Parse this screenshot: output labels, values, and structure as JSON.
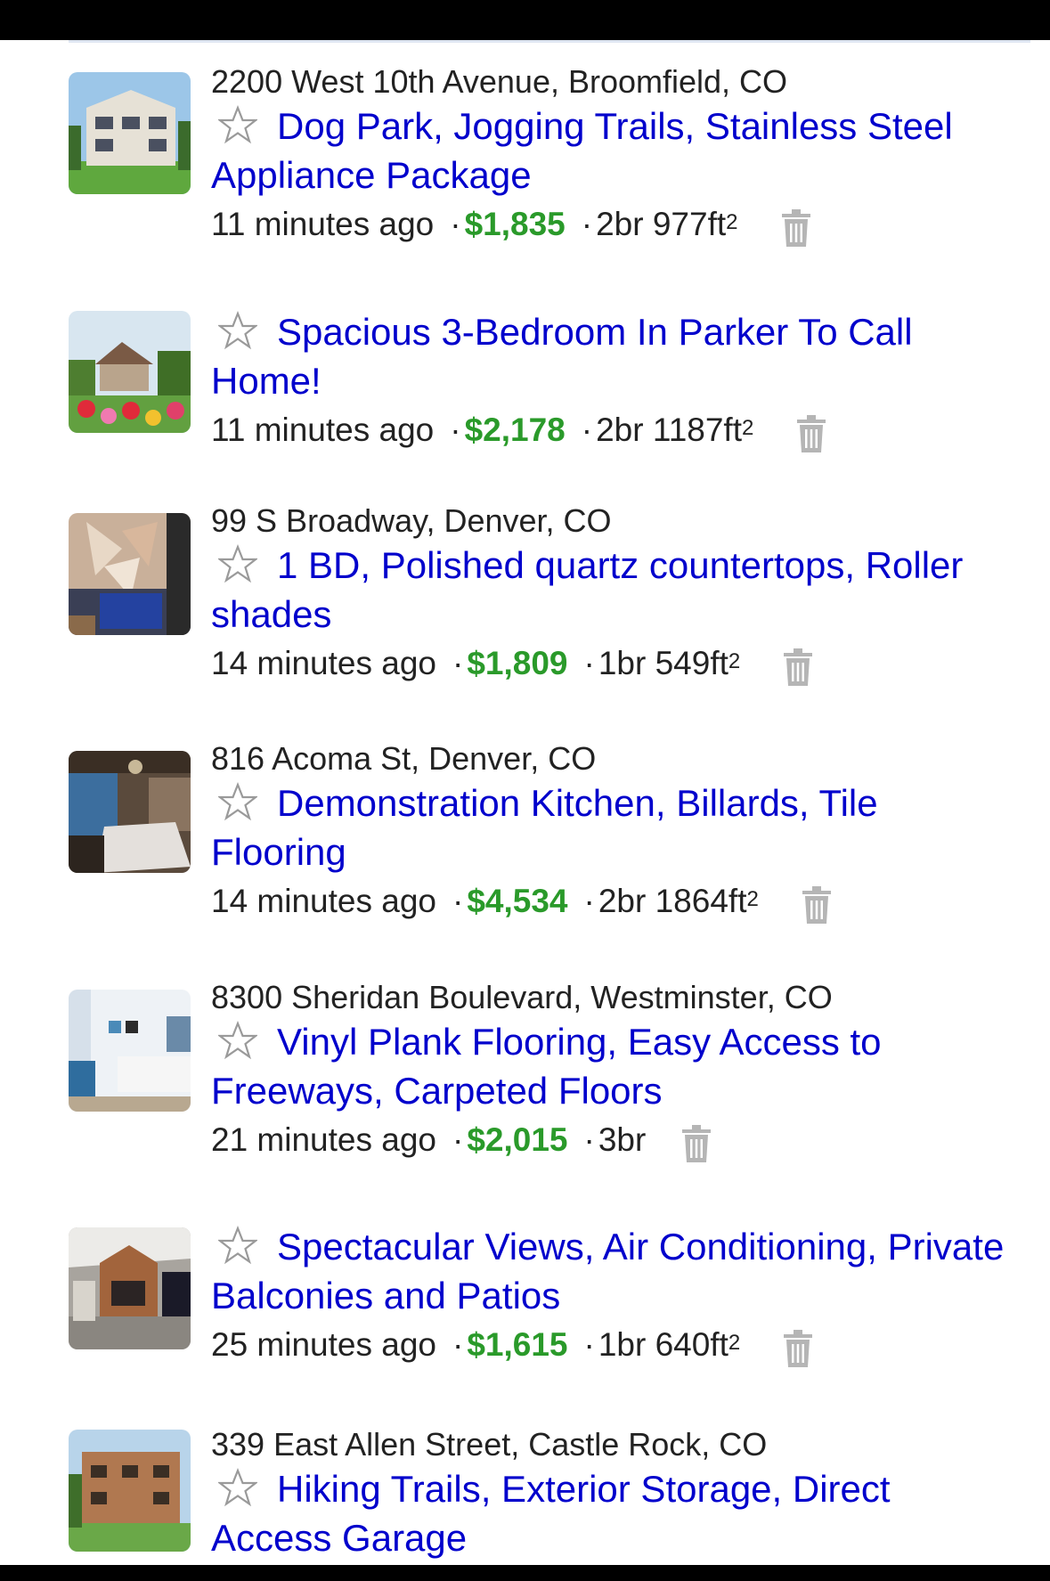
{
  "listings": [
    {
      "address": "2200 West 10th Avenue, Broomfield, CO",
      "title": "Dog Park, Jogging Trails, Stainless Steel Appliance Package",
      "time": "11 minutes ago",
      "price": "$1,835",
      "beds": "2br",
      "size": "977ft",
      "unit_sup": "2",
      "thumb": "apartment-building-photo"
    },
    {
      "address": "",
      "title": "Spacious 3-Bedroom In Parker To Call Home!",
      "time": "11 minutes ago",
      "price": "$2,178",
      "beds": "2br",
      "size": "1187ft",
      "unit_sup": "2",
      "thumb": "garden-flowers-photo"
    },
    {
      "address": "99 S Broadway, Denver, CO",
      "title": "1 BD, Polished quartz countertops, Roller shades",
      "time": "14 minutes ago",
      "price": "$1,809",
      "beds": "1br",
      "size": "549ft",
      "unit_sup": "2",
      "thumb": "kitchen-interior-photo"
    },
    {
      "address": "816 Acoma St, Denver, CO",
      "title": "Demonstration Kitchen, Billards, Tile Flooring",
      "time": "14 minutes ago",
      "price": "$4,534",
      "beds": "2br",
      "size": "1864ft",
      "unit_sup": "2",
      "thumb": "bedroom-interior-photo"
    },
    {
      "address": "8300 Sheridan Boulevard, Westminster, CO",
      "title": "Vinyl Plank Flooring, Easy Access to Freeways, Carpeted Floors",
      "time": "21 minutes ago",
      "price": "$2,015",
      "beds": "3br",
      "size": "",
      "unit_sup": "",
      "thumb": "living-room-photo"
    },
    {
      "address": "",
      "title": "Spectacular Views, Air Conditioning, Private Balconies and Patios",
      "time": "25 minutes ago",
      "price": "$1,615",
      "beds": "1br",
      "size": "640ft",
      "unit_sup": "2",
      "thumb": "clubhouse-interior-photo"
    },
    {
      "address": "339 East Allen Street, Castle Rock, CO",
      "title": "Hiking Trails, Exterior Storage, Direct Access Garage",
      "time": "",
      "price": "",
      "beds": "",
      "size": "",
      "unit_sup": "",
      "thumb": "brick-building-photo"
    }
  ],
  "separator": "·",
  "colors": {
    "title_link": "#0000cc",
    "price": "#2a9a2a",
    "text": "#222222",
    "icon_gray": "#b5b5b5"
  }
}
